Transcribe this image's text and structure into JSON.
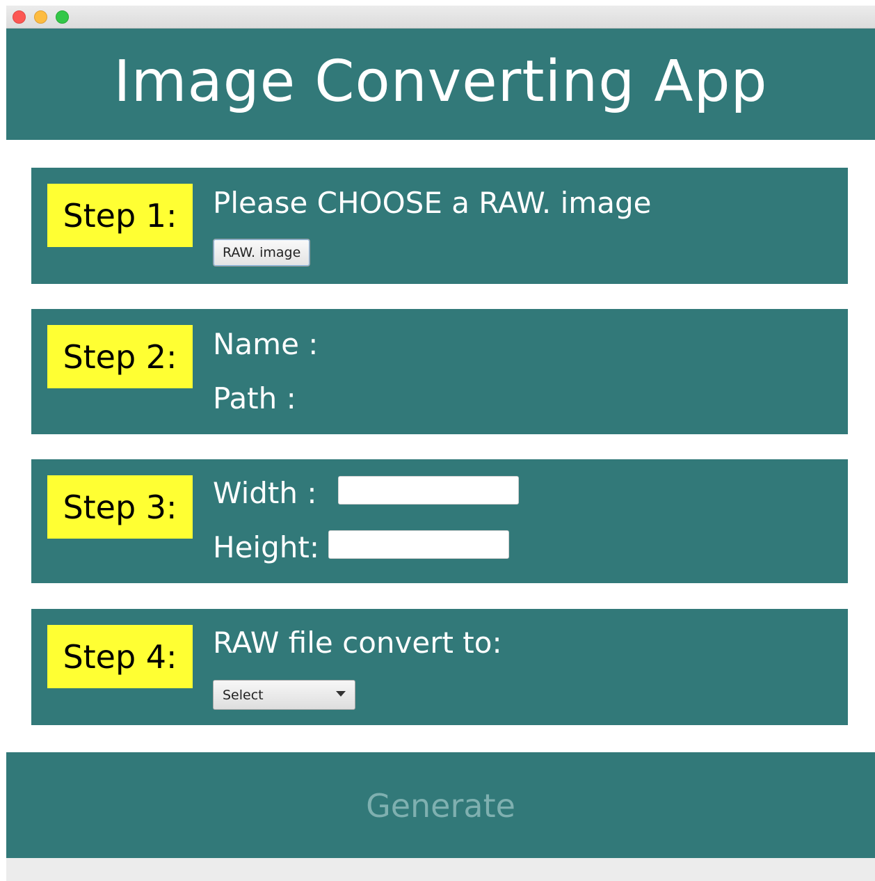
{
  "window": {
    "controls": [
      "close-icon",
      "minimize-icon",
      "maximize-icon"
    ]
  },
  "header": {
    "title": "Image Converting App"
  },
  "steps": [
    {
      "badge": "Step 1:",
      "instruction": "Please CHOOSE a RAW. image",
      "button_label": "RAW. image"
    },
    {
      "badge": "Step 2:",
      "name_label": "Name :",
      "path_label": "Path :"
    },
    {
      "badge": "Step 3:",
      "width_label": "Width :",
      "height_label": "Height:",
      "width_value": "",
      "height_value": ""
    },
    {
      "badge": "Step 4:",
      "instruction": "RAW file convert to:",
      "select_value": "Select"
    }
  ],
  "footer": {
    "generate_label": "Generate"
  },
  "colors": {
    "panel": "#327979",
    "badge": "#ffff33",
    "text": "#ffffff",
    "generate_text": "#7fb0b0"
  }
}
